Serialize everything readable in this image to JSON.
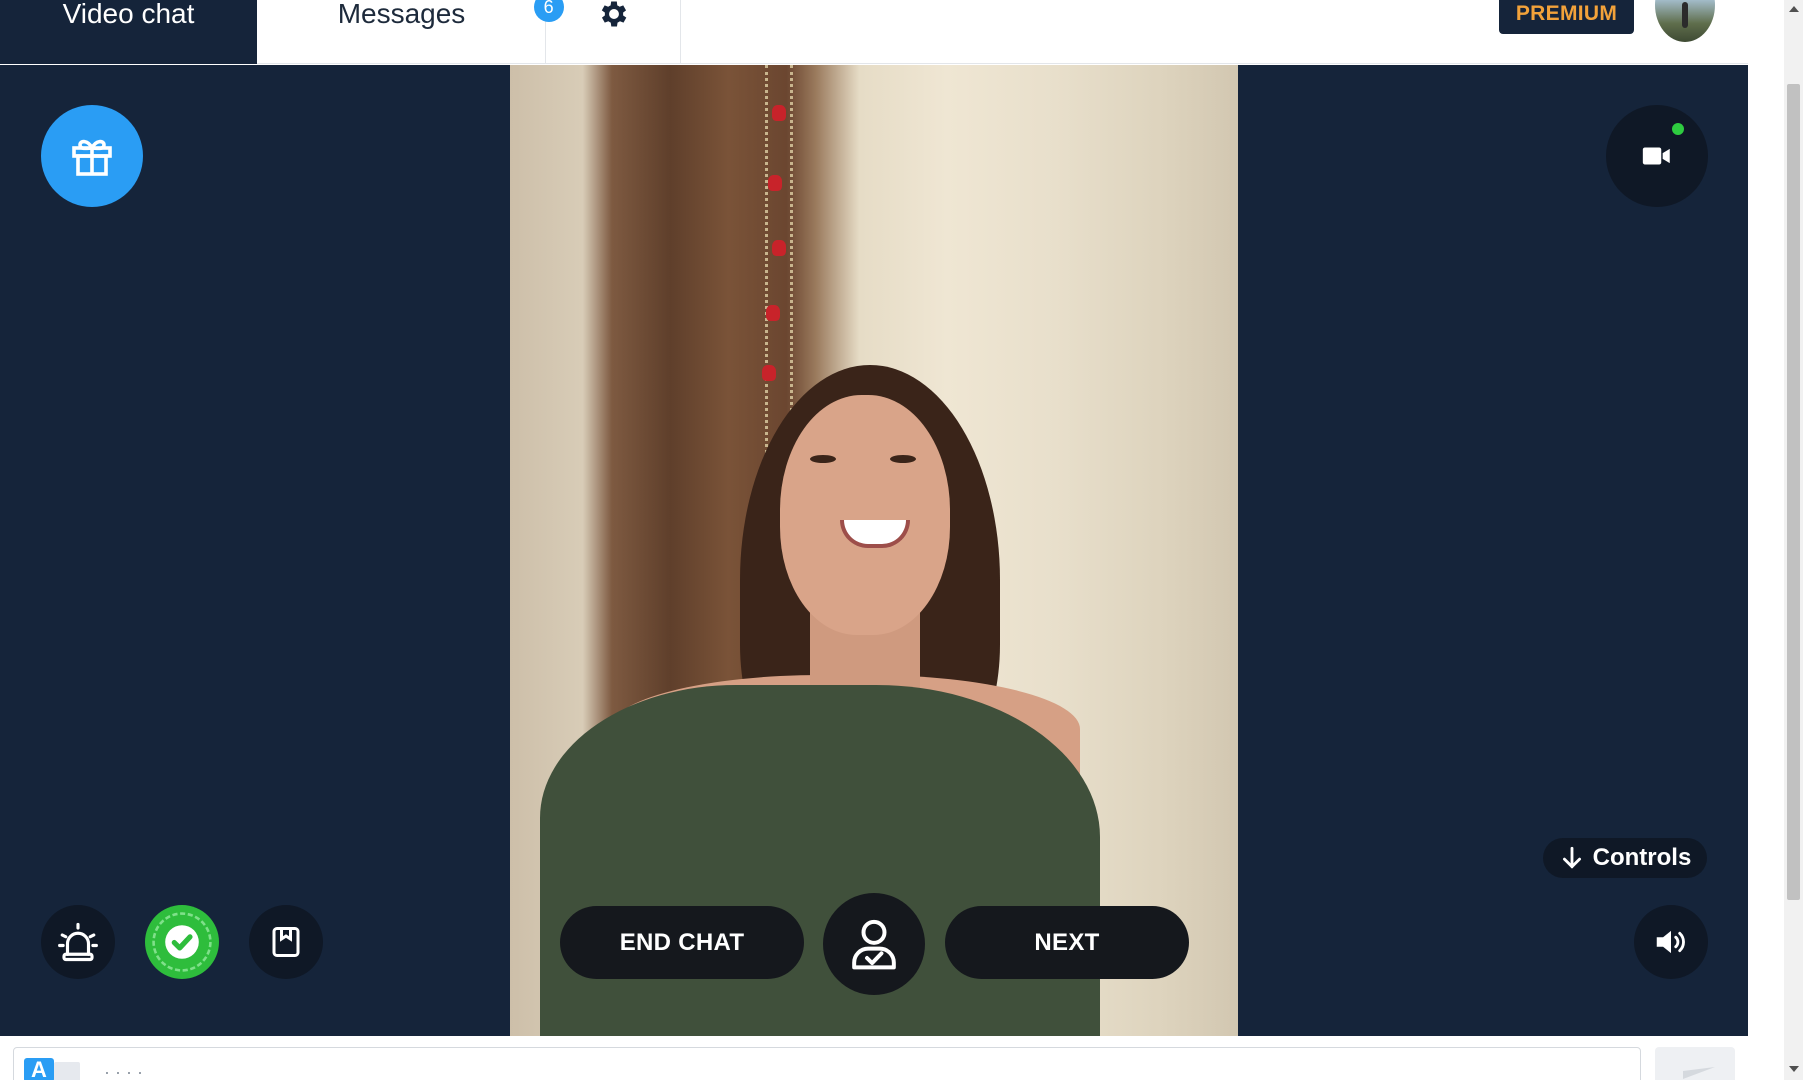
{
  "nav": {
    "video_chat_label": "Video chat",
    "messages_label": "Messages",
    "messages_badge": "6",
    "premium_label": "PREMIUM"
  },
  "icons": {
    "settings": "gear-icon",
    "gift": "gift-icon",
    "camera": "video-camera-icon",
    "alert": "alarm-light-icon",
    "verified": "check-badge-icon",
    "bookmark": "bookmark-icon",
    "profile": "user-check-icon",
    "volume": "speaker-icon",
    "controls": "arrow-down-icon",
    "translate": "translate-icon",
    "send": "send-icon"
  },
  "stage": {
    "controls_label": "Controls",
    "end_chat_label": "END CHAT",
    "next_label": "NEXT",
    "camera_status": "on"
  },
  "chat": {
    "placeholder": "· · · ·"
  },
  "colors": {
    "background": "#15243a",
    "accent_blue": "#2a9df4",
    "premium_text": "#f2a23a",
    "verified_green": "#2ebd3c",
    "camera_status_dot": "#2ecc40"
  }
}
